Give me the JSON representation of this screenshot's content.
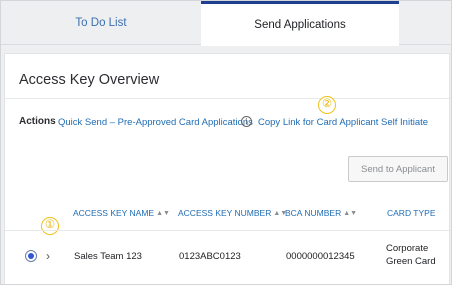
{
  "tabs": [
    {
      "label": "To Do List",
      "active": false
    },
    {
      "label": "Send Applications",
      "active": true
    }
  ],
  "page": {
    "title": "Access Key Overview"
  },
  "actions": {
    "label": "Actions",
    "quick_send": "Quick Send – Pre-Approved Card Applications",
    "info_icon": "i",
    "copy_link": "Copy Link for Card Applicant Self Initiate",
    "send_button": "Send to Applicant"
  },
  "markers": {
    "one": "①",
    "two": "②"
  },
  "table": {
    "columns": [
      "ACCESS KEY NAME",
      "ACCESS KEY NUMBER",
      "BCA NUMBER",
      "CARD TYPE"
    ],
    "rows": [
      {
        "selected": true,
        "name": "Sales Team 123",
        "access_key_number": "0123ABC0123",
        "bca_number": "0000000012345",
        "card_type": "Corporate Green Card"
      }
    ]
  },
  "colors": {
    "accent": "#1f6cb3",
    "active_tab_border": "#1e3f8f",
    "marker": "#f0c21a",
    "radio_selected": "#2f57d8"
  }
}
